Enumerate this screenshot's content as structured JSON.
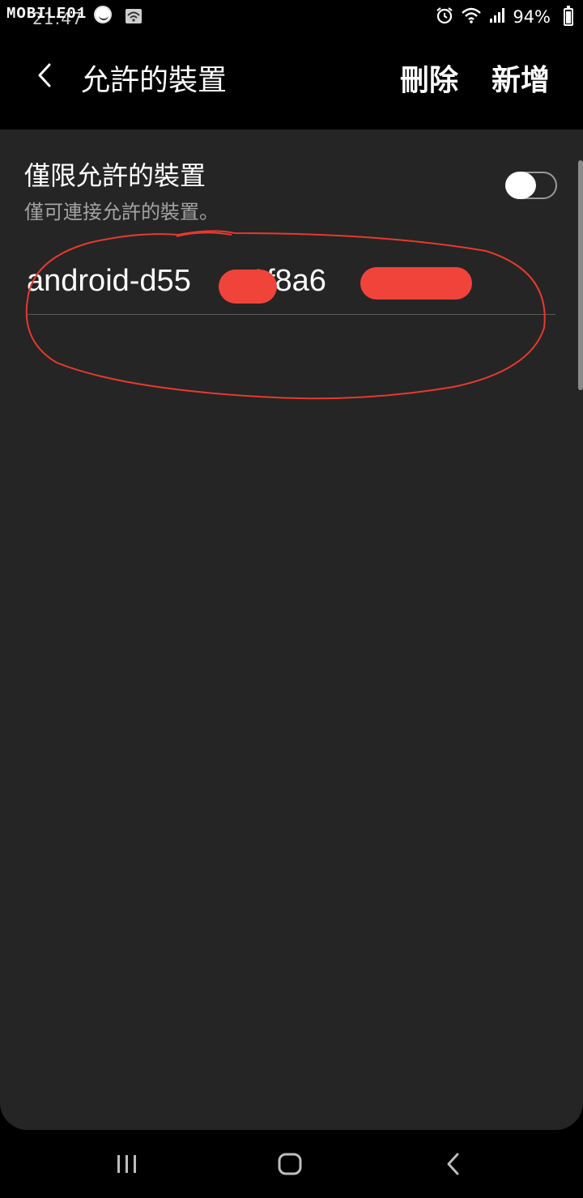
{
  "status_bar": {
    "watermark": "MOBILE01",
    "time": "21:47",
    "battery_percent": "94%",
    "icons": [
      "alarm-icon",
      "wifi-icon",
      "signal-icon",
      "battery-charging-icon"
    ]
  },
  "app_bar": {
    "title": "允許的裝置",
    "delete_label": "刪除",
    "add_label": "新增"
  },
  "setting": {
    "title": "僅限允許的裝置",
    "subtitle": "僅可連接允許的裝置。",
    "toggle_on": false
  },
  "devices": [
    {
      "name_visible": "android-d55",
      "name_visible_2": "1f8a6"
    }
  ],
  "colors": {
    "background": "#000000",
    "card": "#252525",
    "text_primary": "#ffffff",
    "text_secondary": "#a3a3a3",
    "redaction": "#f0443a",
    "annotation_circle": "#e8392f"
  }
}
